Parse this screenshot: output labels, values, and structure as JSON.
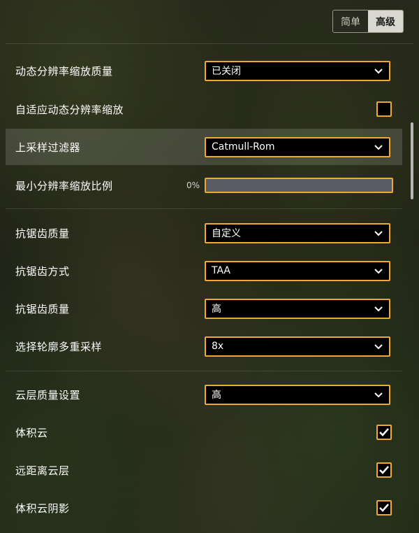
{
  "mode_switch": {
    "simple": "简单",
    "advanced": "高级"
  },
  "settings": {
    "dynamic_res_quality": {
      "label": "动态分辨率缩放质量",
      "value": "已关闭"
    },
    "adaptive_dynamic_res": {
      "label": "自适应动态分辨率缩放",
      "checked": false
    },
    "upsample_filter": {
      "label": "上采样过滤器",
      "value": "Catmull-Rom"
    },
    "min_res_scale": {
      "label": "最小分辨率缩放比例",
      "value": "0%",
      "fraction": 0
    },
    "aa_quality": {
      "label": "抗锯齿质量",
      "value": "自定义"
    },
    "aa_method": {
      "label": "抗锯齿方式",
      "value": "TAA"
    },
    "aa_quality_2": {
      "label": "抗锯齿质量",
      "value": "高"
    },
    "outline_msaa": {
      "label": "选择轮廓多重采样",
      "value": "8x"
    },
    "cloud_quality": {
      "label": "云层质量设置",
      "value": "高"
    },
    "volumetric_clouds": {
      "label": "体积云",
      "checked": true
    },
    "distant_clouds": {
      "label": "远距离云层",
      "checked": true
    },
    "volumetric_cloud_shadows": {
      "label": "体积云阴影",
      "checked": true
    }
  },
  "colors": {
    "accent": "#f0a830",
    "field_bg": "#000000",
    "slider_track": "#5a5d66"
  }
}
